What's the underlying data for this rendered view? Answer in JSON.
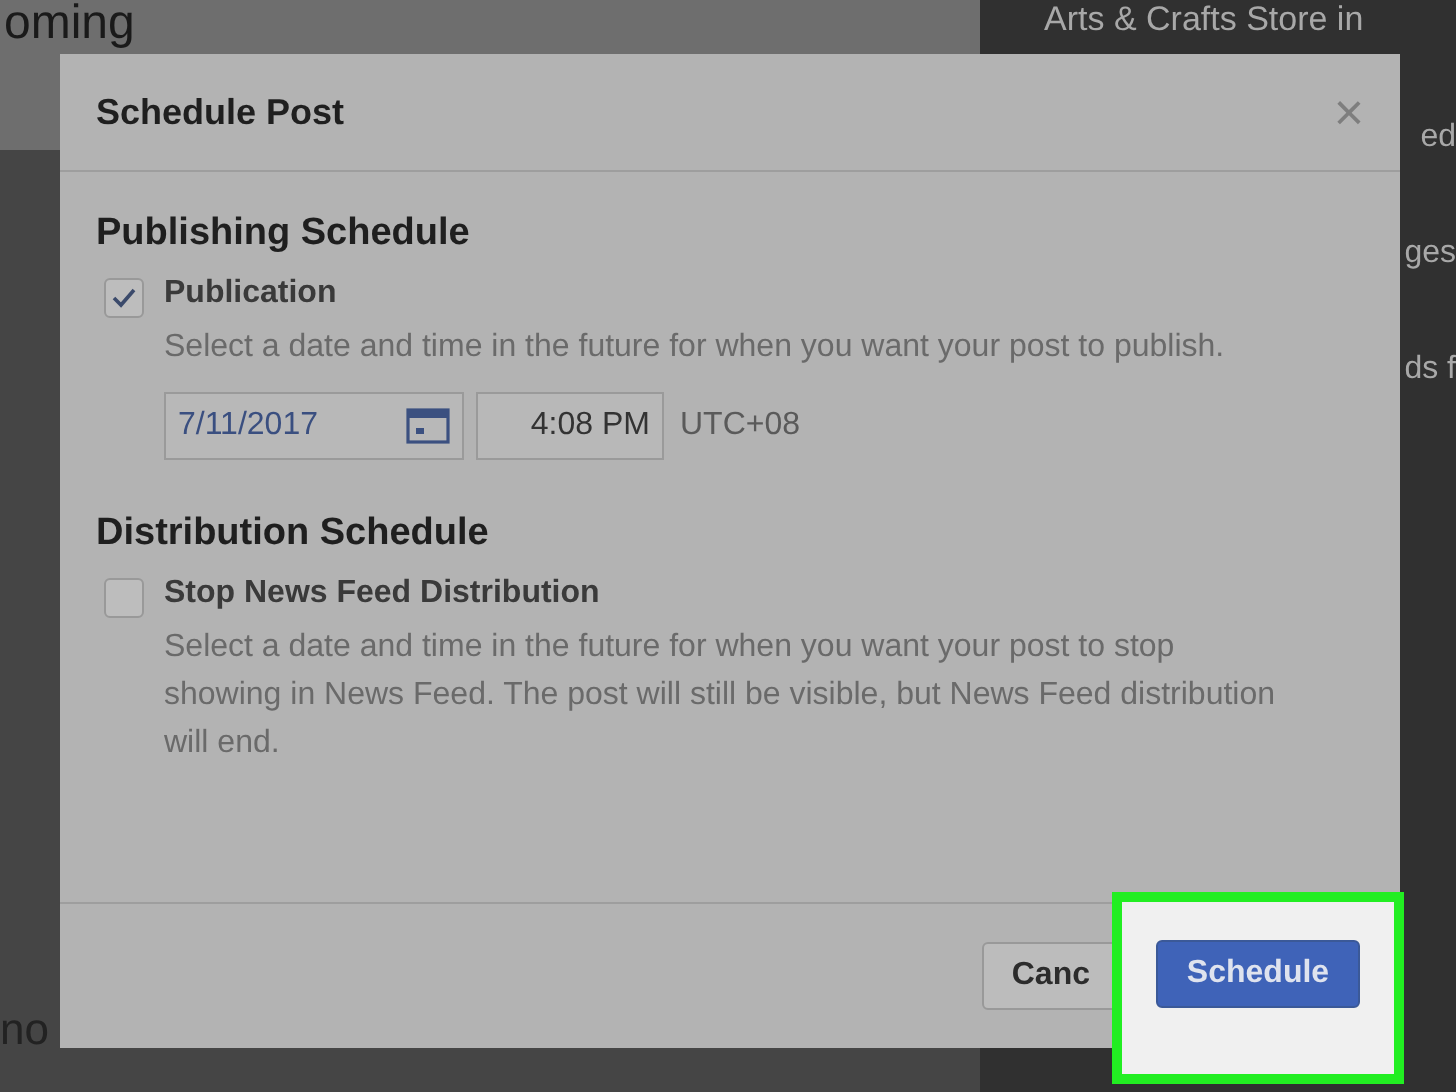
{
  "background": {
    "page_title": "oming",
    "sidebar_title": "Arts & Crafts Store in",
    "sidebar_fragments": [
      "ed",
      "ges",
      "ds f"
    ],
    "footer_fragment": "no"
  },
  "dialog": {
    "title": "Schedule Post",
    "close": "×",
    "sections": [
      {
        "heading": "Publishing Schedule",
        "option": {
          "label": "Publication",
          "checked": true,
          "description": "Select a date and time in the future for when you want your post to publish."
        },
        "date": "7/11/2017",
        "time": "4:08 PM",
        "timezone": "UTC+08"
      },
      {
        "heading": "Distribution Schedule",
        "option": {
          "label": "Stop News Feed Distribution",
          "checked": false,
          "description": "Select a date and time in the future for when you want your post to stop showing in News Feed. The post will still be visible, but News Feed distribution will end."
        }
      }
    ],
    "buttons": [
      {
        "label": "Canc",
        "kind": "secondary"
      },
      {
        "label": "Schedule",
        "kind": "primary",
        "highlighted": true
      }
    ]
  }
}
